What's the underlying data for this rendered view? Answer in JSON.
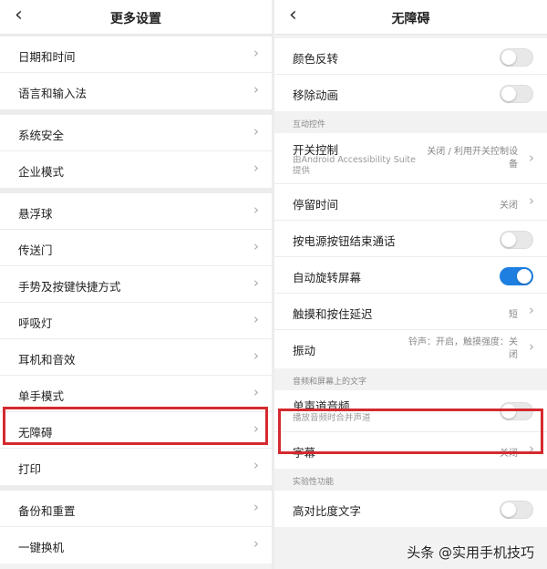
{
  "left": {
    "back_icon": "chevron-left-icon",
    "title": "更多设置",
    "groups": [
      [
        "日期和时间",
        "语言和输入法"
      ],
      [
        "系统安全",
        "企业模式"
      ],
      [
        "悬浮球",
        "传送门",
        "手势及按键快捷方式",
        "呼吸灯",
        "耳机和音效",
        "单手模式",
        "无障碍",
        "打印"
      ],
      [
        "备份和重置",
        "一键换机"
      ]
    ]
  },
  "right": {
    "back_icon": "chevron-left-icon",
    "title": "无障碍",
    "top_items": [
      {
        "label": "颜色反转",
        "toggle": false
      },
      {
        "label": "移除动画",
        "toggle": false
      }
    ],
    "section_interactive": "互动控件",
    "switch_control": {
      "label": "开关控制",
      "sub": "由Android Accessibility Suite提供",
      "value": "关闭 / 利用开关控制设备"
    },
    "dwell_time": {
      "label": "停留时间",
      "value": "关闭"
    },
    "power_end_call": {
      "label": "按电源按钮结束通话",
      "toggle": false
    },
    "auto_rotate": {
      "label": "自动旋转屏幕",
      "toggle": true
    },
    "touch_hold_delay": {
      "label": "触摸和按住延迟",
      "value": "短"
    },
    "vibration": {
      "label": "振动",
      "value": "铃声：开启，触摸强度：关闭"
    },
    "section_audio": "音频和屏幕上的文字",
    "mono_audio": {
      "label": "单声道音频",
      "sub": "播放音频时合并声道",
      "toggle": false
    },
    "captions": {
      "label": "字幕",
      "value": "关闭"
    },
    "section_experimental": "实验性功能",
    "high_contrast": {
      "label": "高对比度文字",
      "toggle": false
    }
  },
  "watermark": "头条 @实用手机技巧",
  "colors": {
    "accent": "#1e7fe0",
    "highlight": "#d42a2f"
  }
}
